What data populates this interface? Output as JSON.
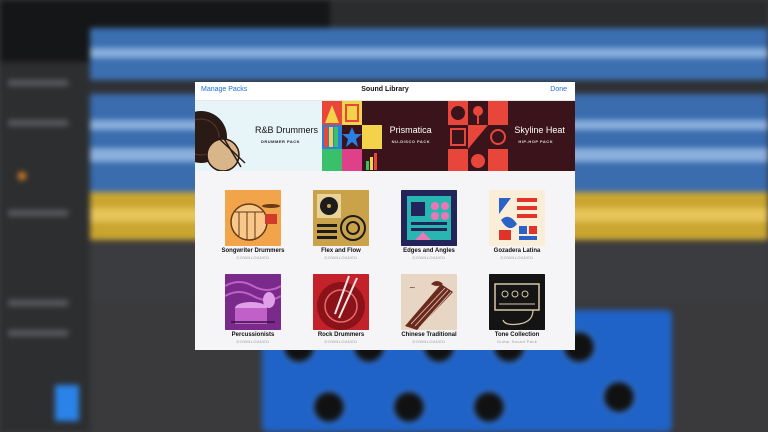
{
  "modal": {
    "title": "Sound Library",
    "manage_label": "Manage Packs",
    "done_label": "Done"
  },
  "banners": [
    {
      "title": "R&B Drummers",
      "subtitle": "DRUMMER PACK",
      "icon": "drum-kit-icon"
    },
    {
      "title": "Prismatica",
      "subtitle": "NU-DISCO PACK",
      "icon": "geometric-pattern-icon"
    },
    {
      "title": "Skyline Heat",
      "subtitle": "HIP-HOP PACK",
      "icon": "microphone-pattern-icon"
    }
  ],
  "packs": [
    {
      "name": "Songwriter Drummers",
      "status": "DOWNLOADED",
      "icon": "drum-kit-icon"
    },
    {
      "name": "Flex and Flow",
      "status": "DOWNLOADED",
      "icon": "turntable-icon"
    },
    {
      "name": "Edges and Angles",
      "status": "DOWNLOADED",
      "icon": "geometric-shapes-icon"
    },
    {
      "name": "Gozadera Latina",
      "status": "DOWNLOADED",
      "icon": "abstract-pattern-icon"
    },
    {
      "name": "Percussionists",
      "status": "DOWNLOADED",
      "icon": "percussion-icon"
    },
    {
      "name": "Rock Drummers",
      "status": "DOWNLOADED",
      "icon": "drumsticks-icon"
    },
    {
      "name": "Chinese Traditional",
      "status": "DOWNLOADED",
      "icon": "guzheng-icon"
    },
    {
      "name": "Tone Collection",
      "status": "Guitar Sound Pack",
      "icon": "amplifier-icon"
    }
  ]
}
